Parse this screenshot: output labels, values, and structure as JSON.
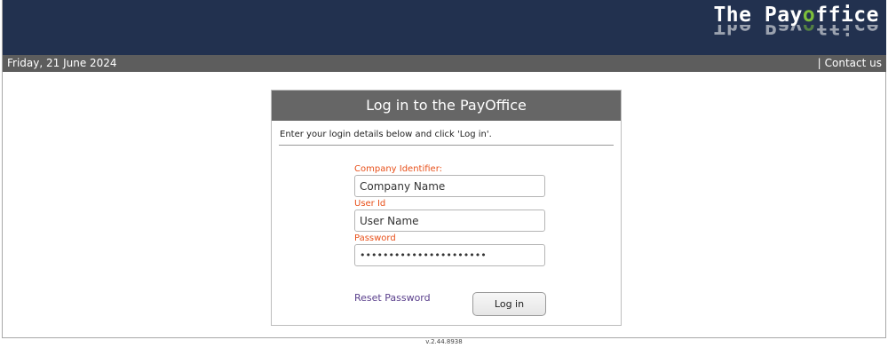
{
  "header": {
    "logo_pre": "The Pay",
    "logo_o": "o",
    "logo_post": "ffice"
  },
  "subbar": {
    "date": "Friday, 21 June 2024",
    "separator": "|",
    "contact": "Contact us"
  },
  "login": {
    "title": "Log in to the PayOffice",
    "instructions": "Enter your login details below and click 'Log in'.",
    "company_label": "Company Identifier:",
    "company_value": "Company Name",
    "user_label": "User Id",
    "user_value": "User Name",
    "password_label": "Password",
    "password_value": "••••••••••••••••••••••",
    "reset_link": "Reset Password",
    "login_button": "Log in"
  },
  "footer": {
    "version": "v.2.44.8938"
  },
  "colors": {
    "header_bg": "#22314f",
    "subbar_bg": "#5d5d5d",
    "panel_title_bg": "#666666",
    "label_color": "#e8501a",
    "link_color": "#5a3f8c",
    "logo_accent": "#7cbf3a"
  }
}
